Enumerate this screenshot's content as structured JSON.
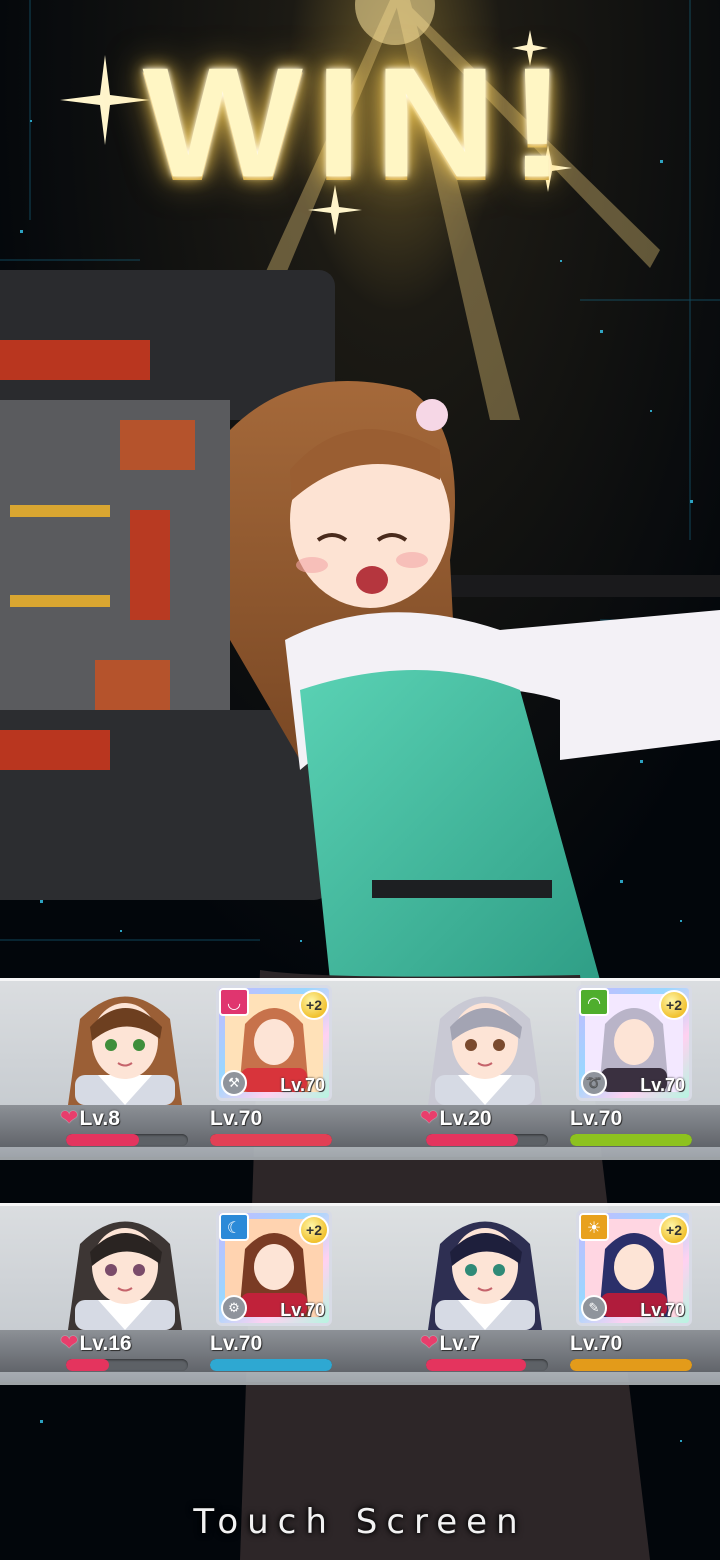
{
  "result": {
    "title": "WIN!",
    "prompt": "Touch Screen"
  },
  "colors": {
    "bond_bar": "#e4345e",
    "bar_track": "#5d6166",
    "outfit": "#46c7a6"
  },
  "party": [
    {
      "members": [
        {
          "name_icon": "brown-hair-idol-portrait",
          "bond_level": "Lv.8",
          "bond_fill": 0.6,
          "card": {
            "attr_icon": "shield-icon",
            "attr_color": "#e0356f",
            "plus": "+2",
            "level": "Lv.70",
            "weapon_icon": "hammer-icon",
            "art_colors": [
              "#ffe1b8",
              "#c7724b",
              "#d8343b"
            ]
          },
          "card_level": "Lv.70",
          "card_fill": 1.0,
          "card_bar_color": "#e24055"
        },
        {
          "name_icon": "silver-hair-idol-portrait",
          "bond_level": "Lv.20",
          "bond_fill": 0.75,
          "card": {
            "attr_icon": "wifi-icon",
            "attr_color": "#4fae2d",
            "plus": "+2",
            "level": "Lv.70",
            "weapon_icon": "boomerang-icon",
            "art_colors": [
              "#f3e8ff",
              "#b9b4c8",
              "#3a3040"
            ]
          },
          "card_level": "Lv.70",
          "card_fill": 1.0,
          "card_bar_color": "#8dc21f"
        }
      ]
    },
    {
      "members": [
        {
          "name_icon": "dark-ponytail-idol-portrait",
          "bond_level": "Lv.16",
          "bond_fill": 0.35,
          "card": {
            "attr_icon": "moon-icon",
            "attr_color": "#2b8ad8",
            "plus": "+2",
            "level": "Lv.70",
            "weapon_icon": "gear-icon",
            "art_colors": [
              "#ffd3b0",
              "#7a3b24",
              "#c0223a"
            ]
          },
          "card_level": "Lv.70",
          "card_fill": 1.0,
          "card_bar_color": "#2ea8d2"
        },
        {
          "name_icon": "navy-hair-idol-portrait",
          "bond_level": "Lv.7",
          "bond_fill": 0.82,
          "card": {
            "attr_icon": "sun-icon",
            "attr_color": "#e8a11d",
            "plus": "+2",
            "level": "Lv.70",
            "weapon_icon": "wrench-icon",
            "art_colors": [
              "#ffd6e2",
              "#2b2f6a",
              "#b01c3c"
            ]
          },
          "card_level": "Lv.70",
          "card_fill": 1.0,
          "card_bar_color": "#e39b1a"
        }
      ]
    }
  ]
}
